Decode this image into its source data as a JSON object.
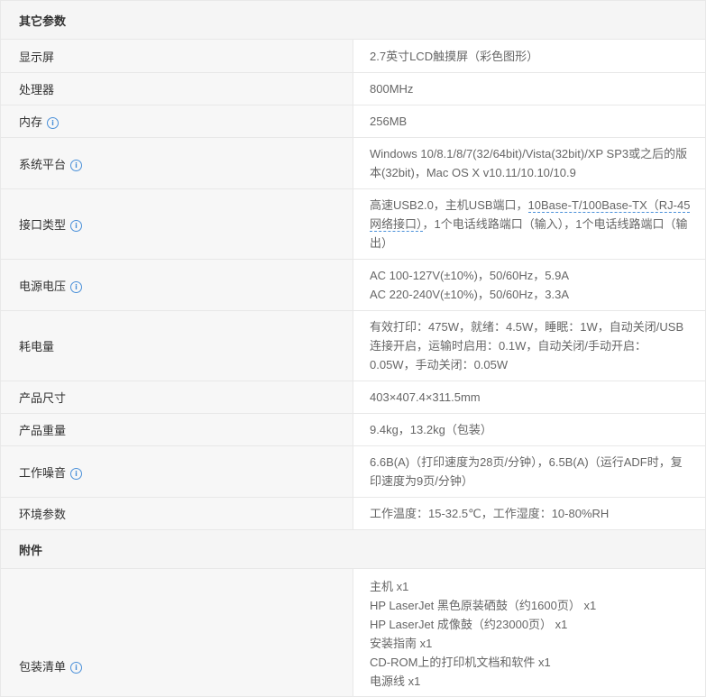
{
  "sections": {
    "other": "其它参数",
    "accessories": "附件"
  },
  "rows": {
    "display": {
      "label": "显示屏",
      "value": "2.7英寸LCD触摸屏（彩色图形）"
    },
    "processor": {
      "label": "处理器",
      "value": "800MHz"
    },
    "memory": {
      "label": "内存",
      "value": "256MB"
    },
    "platform": {
      "label": "系统平台",
      "value": "Windows 10/8.1/8/7(32/64bit)/Vista(32bit)/XP SP3或之后的版本(32bit)，Mac OS X v10.11/10.10/10.9"
    },
    "interface": {
      "label": "接口类型",
      "value_a": "高速USB2.0，主机USB端口，",
      "value_link": "10Base-T/100Base-TX（RJ-45网络接口）",
      "value_b": "，1个电话线路端口（输入），1个电话线路端口（输出）"
    },
    "power_voltage": {
      "label": "电源电压",
      "line1": "AC 100-127V(±10%)，50/60Hz，5.9A",
      "line2": "AC 220-240V(±10%)，50/60Hz，3.3A"
    },
    "power_consumption": {
      "label": "耗电量",
      "value": "有效打印：475W，就绪：4.5W，睡眠：1W，自动关闭/USB连接开启，运输时启用：0.1W，自动关闭/手动开启：0.05W，手动关闭：0.05W"
    },
    "dimensions": {
      "label": "产品尺寸",
      "value": "403×407.4×311.5mm"
    },
    "weight": {
      "label": "产品重量",
      "value": "9.4kg，13.2kg（包装）"
    },
    "noise": {
      "label": "工作噪音",
      "value": "6.6B(A)（打印速度为28页/分钟），6.5B(A)（运行ADF时，复印速度为9页/分钟）"
    },
    "environment": {
      "label": "环境参数",
      "value": "工作温度：15-32.5℃，工作湿度：10-80%RH"
    },
    "package": {
      "label": "包装清单",
      "items": [
        "主机  x1",
        "HP LaserJet 黑色原装硒鼓（约1600页）  x1",
        "HP LaserJet 成像鼓（约23000页）  x1",
        "安装指南  x1",
        "CD-ROM上的打印机文档和软件  x1",
        "电源线  x1"
      ]
    }
  },
  "icons": {
    "info": "info-icon",
    "info_glyph": "i"
  },
  "colors": {
    "accent": "#4a90d9",
    "label_bg": "#f7f7f7",
    "section_bg": "#f5f5f5",
    "border": "#e8e8e8"
  }
}
